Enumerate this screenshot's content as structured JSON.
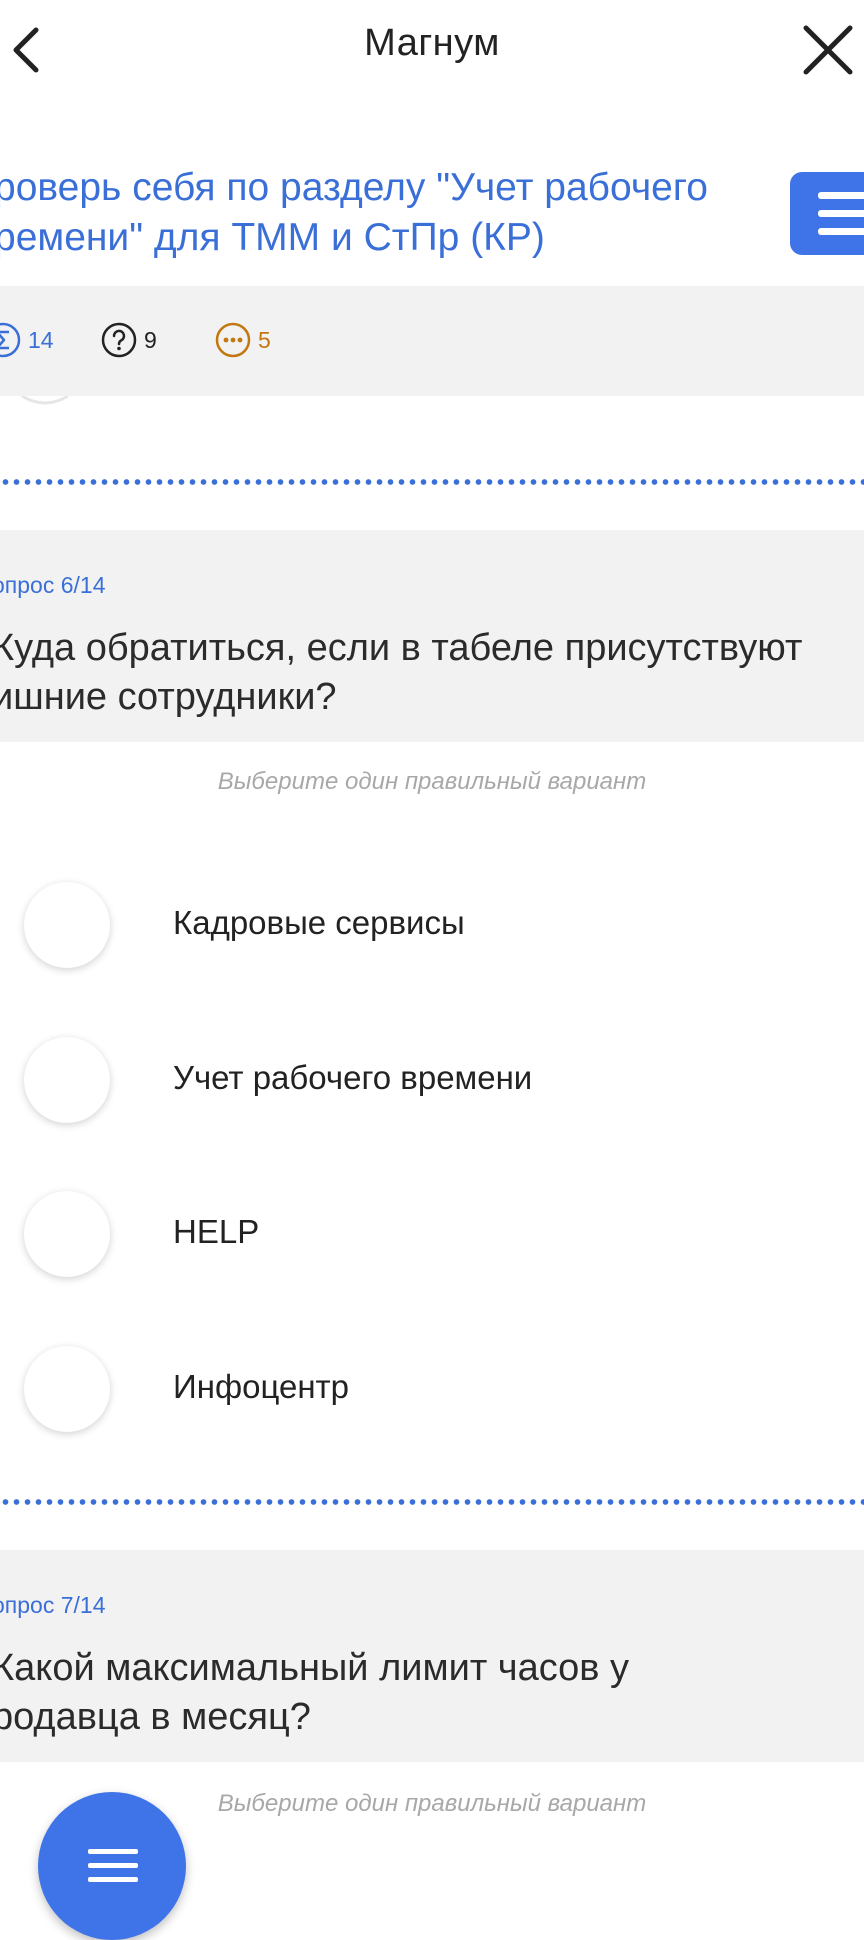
{
  "header": {
    "title": "Магнум",
    "back_icon": "chevron-left-icon",
    "close_icon": "close-icon"
  },
  "quiz": {
    "title": "роверь себя по разделу \"Учет рабочего\nремени\" для ТММ и СтПр (КР)",
    "menu_icon": "menu-icon"
  },
  "stats": {
    "total": "14",
    "questions": "9",
    "pending": "5"
  },
  "questions": [
    {
      "number": "опрос 6/14",
      "text": "Куда обратиться, если в табеле присутствуют\nишние сотрудники?",
      "hint": "Выберите один правильный вариант",
      "options": [
        "Кадровые сервисы",
        "Учет рабочего времени",
        "HELP",
        "Инфоцентр"
      ]
    },
    {
      "number": "опрос 7/14",
      "text": "Какой максимальный лимит часов у\nродавца в месяц?",
      "hint": "Выберите один правильный вариант"
    }
  ],
  "fab": {
    "icon": "menu-icon"
  },
  "colors": {
    "accent": "#3f74e8",
    "link": "#3b6fd8",
    "pending": "#c2770f",
    "card_bg": "#f2f2f2"
  }
}
